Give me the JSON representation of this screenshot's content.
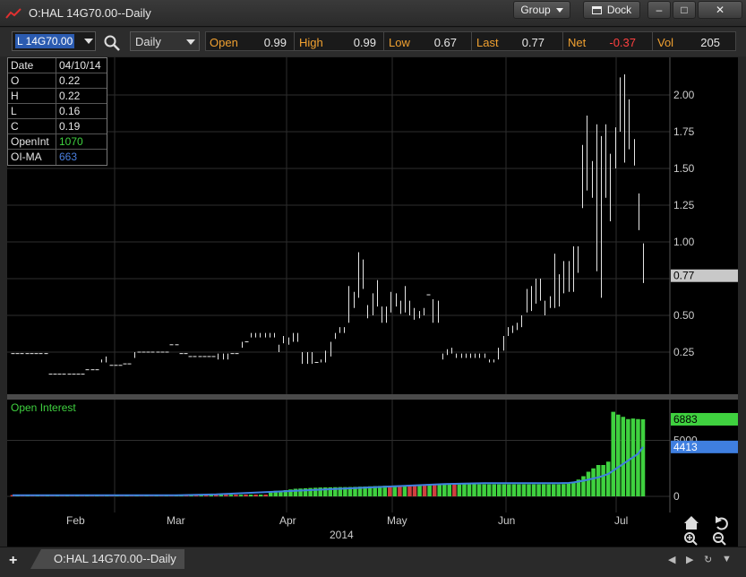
{
  "window": {
    "title": "O:HAL 14G70.00--Daily",
    "group_label": "Group",
    "dock_label": "Dock",
    "min_glyph": "‒",
    "max_glyph": "□",
    "close_glyph": "✕"
  },
  "toolbar": {
    "symbol": "L 14G70.00",
    "interval": "Daily",
    "quote": {
      "open_label": "Open",
      "open": "0.99",
      "high_label": "High",
      "high": "0.99",
      "low_label": "Low",
      "low": "0.67",
      "last_label": "Last",
      "last": "0.77",
      "net_label": "Net",
      "net": "-0.37",
      "vol_label": "Vol",
      "vol": "205"
    }
  },
  "data_window": [
    {
      "key": "Date",
      "value": "04/10/14",
      "color": "#e6e6e6"
    },
    {
      "key": "O",
      "value": "0.22",
      "color": "#e6e6e6"
    },
    {
      "key": "H",
      "value": "0.22",
      "color": "#e6e6e6"
    },
    {
      "key": "L",
      "value": "0.16",
      "color": "#e6e6e6"
    },
    {
      "key": "C",
      "value": "0.19",
      "color": "#e6e6e6"
    },
    {
      "key": "OpenInt",
      "value": "1070",
      "color": "#3fd13f"
    },
    {
      "key": "OI-MA",
      "value": "663",
      "color": "#4a7fe0"
    }
  ],
  "colors": {
    "up_bar": "#3fd13f",
    "down_bar": "#d13f3f",
    "ma_line": "#3f7fe0",
    "net_negative": "#ff4040",
    "last_marker": "#c8c8c8"
  },
  "chart_data": [
    {
      "type": "ohlc",
      "title": "O:HAL 14G70.00--Daily",
      "y_ticks": [
        2.0,
        1.75,
        1.5,
        1.25,
        1.0,
        0.5,
        0.25
      ],
      "y_tick_labels": [
        "2.00",
        "1.75",
        "1.50",
        "1.25",
        "1.00",
        "0.50",
        "0.25"
      ],
      "last_price_label": "0.77",
      "last_price": 0.77,
      "ylim": [
        0.0,
        2.2
      ],
      "x_labels": [
        "Feb",
        "Mar",
        "Apr",
        "May",
        "Jun",
        "Jul"
      ],
      "year_label": "2014",
      "grid": true,
      "bars": [
        {
          "h": 0.24,
          "l": 0.24
        },
        {
          "h": 0.24,
          "l": 0.24
        },
        {
          "h": 0.24,
          "l": 0.24
        },
        {
          "h": 0.24,
          "l": 0.24
        },
        {
          "h": 0.24,
          "l": 0.24
        },
        {
          "h": 0.24,
          "l": 0.24
        },
        {
          "h": 0.24,
          "l": 0.24
        },
        {
          "h": 0.24,
          "l": 0.24
        },
        {
          "h": 0.1,
          "l": 0.1
        },
        {
          "h": 0.1,
          "l": 0.1
        },
        {
          "h": 0.1,
          "l": 0.1
        },
        {
          "h": 0.1,
          "l": 0.1
        },
        {
          "h": 0.1,
          "l": 0.1
        },
        {
          "h": 0.1,
          "l": 0.1
        },
        {
          "h": 0.1,
          "l": 0.1
        },
        {
          "h": 0.1,
          "l": 0.1
        },
        {
          "h": 0.13,
          "l": 0.13
        },
        {
          "h": 0.13,
          "l": 0.13
        },
        {
          "h": 0.13,
          "l": 0.13
        },
        {
          "h": 0.2,
          "l": 0.18
        },
        {
          "h": 0.22,
          "l": 0.18
        },
        {
          "h": 0.16,
          "l": 0.16
        },
        {
          "h": 0.16,
          "l": 0.16
        },
        {
          "h": 0.16,
          "l": 0.16
        },
        {
          "h": 0.17,
          "l": 0.17
        },
        {
          "h": 0.17,
          "l": 0.17
        },
        {
          "h": 0.25,
          "l": 0.21
        },
        {
          "h": 0.25,
          "l": 0.25
        },
        {
          "h": 0.25,
          "l": 0.25
        },
        {
          "h": 0.25,
          "l": 0.25
        },
        {
          "h": 0.25,
          "l": 0.25
        },
        {
          "h": 0.25,
          "l": 0.25
        },
        {
          "h": 0.25,
          "l": 0.25
        },
        {
          "h": 0.25,
          "l": 0.25
        },
        {
          "h": 0.3,
          "l": 0.3
        },
        {
          "h": 0.3,
          "l": 0.3
        },
        {
          "h": 0.24,
          "l": 0.24
        },
        {
          "h": 0.24,
          "l": 0.24
        },
        {
          "h": 0.22,
          "l": 0.22
        },
        {
          "h": 0.22,
          "l": 0.22
        },
        {
          "h": 0.22,
          "l": 0.22
        },
        {
          "h": 0.22,
          "l": 0.22
        },
        {
          "h": 0.22,
          "l": 0.22
        },
        {
          "h": 0.22,
          "l": 0.22
        },
        {
          "h": 0.24,
          "l": 0.2
        },
        {
          "h": 0.24,
          "l": 0.2
        },
        {
          "h": 0.24,
          "l": 0.2
        },
        {
          "h": 0.24,
          "l": 0.24
        },
        {
          "h": 0.24,
          "l": 0.24
        },
        {
          "h": 0.32,
          "l": 0.28
        },
        {
          "h": 0.32,
          "l": 0.32
        },
        {
          "h": 0.38,
          "l": 0.35
        },
        {
          "h": 0.38,
          "l": 0.35
        },
        {
          "h": 0.38,
          "l": 0.35
        },
        {
          "h": 0.38,
          "l": 0.35
        },
        {
          "h": 0.38,
          "l": 0.35
        },
        {
          "h": 0.38,
          "l": 0.35
        },
        {
          "h": 0.3,
          "l": 0.25
        },
        {
          "h": 0.36,
          "l": 0.31
        },
        {
          "h": 0.35,
          "l": 0.3
        },
        {
          "h": 0.38,
          "l": 0.32
        },
        {
          "h": 0.38,
          "l": 0.32
        },
        {
          "h": 0.25,
          "l": 0.17
        },
        {
          "h": 0.25,
          "l": 0.17
        },
        {
          "h": 0.25,
          "l": 0.17
        },
        {
          "h": 0.18,
          "l": 0.18
        },
        {
          "h": 0.2,
          "l": 0.18
        },
        {
          "h": 0.26,
          "l": 0.18
        },
        {
          "h": 0.32,
          "l": 0.22
        },
        {
          "h": 0.38,
          "l": 0.34
        },
        {
          "h": 0.42,
          "l": 0.38
        },
        {
          "h": 0.42,
          "l": 0.38
        },
        {
          "h": 0.7,
          "l": 0.45
        },
        {
          "h": 0.66,
          "l": 0.55
        },
        {
          "h": 0.93,
          "l": 0.62
        },
        {
          "h": 0.88,
          "l": 0.68
        },
        {
          "h": 0.57,
          "l": 0.48
        },
        {
          "h": 0.65,
          "l": 0.5
        },
        {
          "h": 0.74,
          "l": 0.56
        },
        {
          "h": 0.56,
          "l": 0.45
        },
        {
          "h": 0.56,
          "l": 0.45
        },
        {
          "h": 0.66,
          "l": 0.52
        },
        {
          "h": 0.65,
          "l": 0.56
        },
        {
          "h": 0.6,
          "l": 0.51
        },
        {
          "h": 0.7,
          "l": 0.52
        },
        {
          "h": 0.6,
          "l": 0.5
        },
        {
          "h": 0.55,
          "l": 0.47
        },
        {
          "h": 0.53,
          "l": 0.48
        },
        {
          "h": 0.55,
          "l": 0.5
        },
        {
          "h": 0.64,
          "l": 0.64
        },
        {
          "h": 0.61,
          "l": 0.45
        },
        {
          "h": 0.6,
          "l": 0.45
        },
        {
          "h": 0.24,
          "l": 0.2
        },
        {
          "h": 0.27,
          "l": 0.23
        },
        {
          "h": 0.28,
          "l": 0.24
        },
        {
          "h": 0.24,
          "l": 0.21
        },
        {
          "h": 0.24,
          "l": 0.21
        },
        {
          "h": 0.24,
          "l": 0.21
        },
        {
          "h": 0.24,
          "l": 0.21
        },
        {
          "h": 0.24,
          "l": 0.21
        },
        {
          "h": 0.24,
          "l": 0.21
        },
        {
          "h": 0.24,
          "l": 0.21
        },
        {
          "h": 0.2,
          "l": 0.18
        },
        {
          "h": 0.2,
          "l": 0.18
        },
        {
          "h": 0.28,
          "l": 0.2
        },
        {
          "h": 0.36,
          "l": 0.26
        },
        {
          "h": 0.42,
          "l": 0.36
        },
        {
          "h": 0.43,
          "l": 0.38
        },
        {
          "h": 0.45,
          "l": 0.4
        },
        {
          "h": 0.5,
          "l": 0.42
        },
        {
          "h": 0.68,
          "l": 0.52
        },
        {
          "h": 0.7,
          "l": 0.53
        },
        {
          "h": 0.75,
          "l": 0.58
        },
        {
          "h": 0.75,
          "l": 0.6
        },
        {
          "h": 0.6,
          "l": 0.5
        },
        {
          "h": 0.63,
          "l": 0.55
        },
        {
          "h": 0.92,
          "l": 0.55
        },
        {
          "h": 0.78,
          "l": 0.56
        },
        {
          "h": 0.87,
          "l": 0.65
        },
        {
          "h": 0.87,
          "l": 0.66
        },
        {
          "h": 0.97,
          "l": 0.66
        },
        {
          "h": 0.97,
          "l": 0.79
        },
        {
          "h": 1.66,
          "l": 1.23
        },
        {
          "h": 1.86,
          "l": 1.35
        },
        {
          "h": 1.55,
          "l": 1.3
        },
        {
          "h": 1.8,
          "l": 0.8
        },
        {
          "h": 1.72,
          "l": 0.62
        },
        {
          "h": 1.8,
          "l": 1.3
        },
        {
          "h": 1.6,
          "l": 1.14
        },
        {
          "h": 1.78,
          "l": 1.5
        },
        {
          "h": 2.12,
          "l": 1.75
        },
        {
          "h": 2.14,
          "l": 1.54
        },
        {
          "h": 1.97,
          "l": 1.63
        },
        {
          "h": 1.7,
          "l": 1.52
        },
        {
          "h": 1.33,
          "l": 1.08
        },
        {
          "h": 0.99,
          "l": 0.72
        }
      ]
    },
    {
      "type": "bar",
      "title": "Open Interest",
      "y_tick_labels": [
        "5000",
        "0"
      ],
      "y_ticks": [
        5000,
        0
      ],
      "last_oi_label": "6883",
      "last_oi": 6883,
      "last_ma_label": "4413",
      "last_ma": 4413,
      "ylim": [
        0,
        8000
      ],
      "values": [
        120,
        120,
        120,
        120,
        120,
        120,
        120,
        120,
        120,
        120,
        120,
        120,
        120,
        120,
        120,
        120,
        120,
        120,
        120,
        120,
        120,
        120,
        120,
        120,
        120,
        120,
        120,
        120,
        120,
        120,
        120,
        120,
        120,
        120,
        150,
        150,
        150,
        150,
        150,
        150,
        150,
        150,
        150,
        150,
        150,
        150,
        150,
        160,
        160,
        160,
        160,
        160,
        350,
        500,
        520,
        560,
        620,
        680,
        700,
        720,
        750,
        770,
        790,
        800,
        810,
        820,
        830,
        830,
        840,
        850,
        870,
        880,
        900,
        920,
        930,
        950,
        960,
        970,
        990,
        990,
        1000,
        1010,
        1010,
        1020,
        1030,
        1030,
        1040,
        1060,
        1060,
        1070,
        1070,
        1080,
        1080,
        1080,
        1080,
        1080,
        1080,
        1080,
        1080,
        1080,
        1080,
        1080,
        1080,
        1080,
        1080,
        1080,
        1080,
        1080,
        1080,
        1080,
        1080,
        1100,
        1150,
        1250,
        1500,
        1800,
        2200,
        2500,
        2800,
        2800,
        3100,
        7550,
        7300,
        7100,
        6900,
        6950,
        6900,
        6883
      ],
      "direction": [
        "d",
        "u",
        "d",
        "u",
        "d",
        "u",
        "d",
        "u",
        "d",
        "u",
        "d",
        "u",
        "d",
        "u",
        "d",
        "u",
        "d",
        "u",
        "d",
        "u",
        "d",
        "u",
        "d",
        "u",
        "d",
        "u",
        "d",
        "u",
        "d",
        "u",
        "d",
        "u",
        "d",
        "u",
        "u",
        "d",
        "u",
        "d",
        "u",
        "d",
        "u",
        "d",
        "u",
        "d",
        "u",
        "d",
        "u",
        "d",
        "u",
        "d",
        "u",
        "d",
        "u",
        "u",
        "u",
        "u",
        "u",
        "u",
        "u",
        "u",
        "u",
        "u",
        "u",
        "u",
        "u",
        "u",
        "u",
        "u",
        "u",
        "u",
        "u",
        "u",
        "u",
        "u",
        "u",
        "u",
        "d",
        "u",
        "d",
        "u",
        "d",
        "d",
        "u",
        "d",
        "u",
        "d",
        "u",
        "u",
        "u",
        "d",
        "u",
        "u",
        "u",
        "u",
        "u",
        "u",
        "u",
        "u",
        "u",
        "u",
        "u",
        "u",
        "u",
        "u",
        "u",
        "u",
        "u",
        "u",
        "u",
        "u",
        "u",
        "u",
        "u",
        "u",
        "u",
        "u",
        "u",
        "u",
        "u",
        "u",
        "u",
        "u",
        "u",
        "u",
        "u",
        "u",
        "u",
        "u",
        "u",
        "u",
        "u",
        "u",
        "d",
        "d",
        "d",
        "d",
        "d",
        "d",
        "d",
        "d"
      ],
      "ma": [
        100,
        100,
        100,
        100,
        100,
        100,
        100,
        100,
        100,
        100,
        100,
        100,
        100,
        100,
        100,
        100,
        100,
        100,
        100,
        100,
        100,
        100,
        100,
        100,
        100,
        100,
        100,
        100,
        100,
        100,
        100,
        100,
        100,
        100,
        110,
        120,
        130,
        140,
        150,
        160,
        170,
        180,
        200,
        220,
        240,
        260,
        280,
        300,
        320,
        340,
        360,
        380,
        400,
        420,
        440,
        460,
        480,
        500,
        520,
        540,
        560,
        580,
        600,
        620,
        640,
        660,
        680,
        700,
        720,
        740,
        760,
        780,
        800,
        820,
        840,
        860,
        880,
        900,
        920,
        940,
        960,
        980,
        1000,
        1020,
        1040,
        1060,
        1080,
        1100,
        1110,
        1120,
        1130,
        1140,
        1150,
        1160,
        1170,
        1180,
        1180,
        1180,
        1180,
        1180,
        1180,
        1180,
        1180,
        1180,
        1180,
        1180,
        1180,
        1180,
        1180,
        1180,
        1180,
        1190,
        1200,
        1250,
        1320,
        1400,
        1500,
        1600,
        1700,
        1850,
        2000,
        2300,
        2600,
        2900,
        3200,
        3500,
        3800,
        4413
      ]
    }
  ]
}
